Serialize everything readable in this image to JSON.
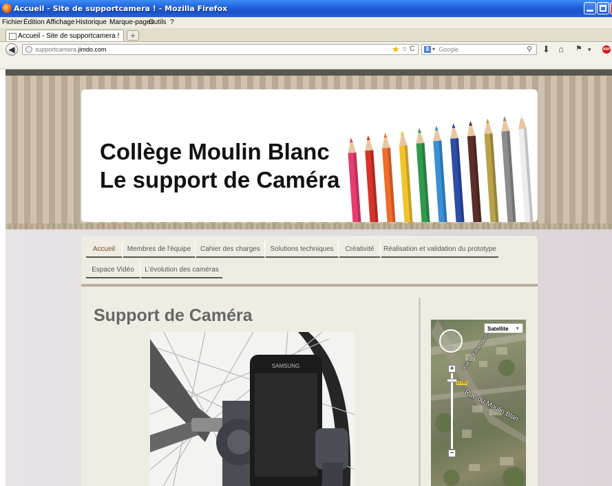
{
  "window": {
    "title": "Accueil - Site de supportcamera ! - Mozilla Firefox",
    "icon": "firefox-icon"
  },
  "menu": [
    "Fichier",
    "Édition",
    "Affichage",
    "Historique",
    "Marque-pages",
    "Outils",
    "?"
  ],
  "tab": {
    "label": "Accueil - Site de supportcamera !",
    "new_tab": "+"
  },
  "address": {
    "prefix": "supportcamera.",
    "domain": "jimdo.com"
  },
  "search": {
    "engine_letter": "8",
    "placeholder": "Google"
  },
  "header": {
    "line1": "Collège Moulin Blanc",
    "line2": "Le support de Caméra",
    "pencil_colors": [
      "#e53d6e",
      "#d6332b",
      "#ef6d2a",
      "#f2c32c",
      "#2f9a4c",
      "#3a8fd6",
      "#2d4ea8",
      "#5b2e2a",
      "#b8a24a",
      "#8d8d8d",
      "#ededed"
    ]
  },
  "nav": {
    "items": [
      "Accueil",
      "Membres de l'équipe",
      "Cahier des charges",
      "Solutions techniques",
      "Créativité",
      "Réalisation et validation du prototype",
      "Espace Vidéo",
      "L'évolution des caméras"
    ]
  },
  "main": {
    "title": "Support de Caméra",
    "phone_brand": "SAMSUNG"
  },
  "map": {
    "type_label": "Satellite",
    "zoom_in": "+",
    "zoom_out": "−",
    "road_sign": "D165",
    "street_1": "Rue du Moulin Blan",
    "street_2": "Rue de Kerampéré"
  }
}
